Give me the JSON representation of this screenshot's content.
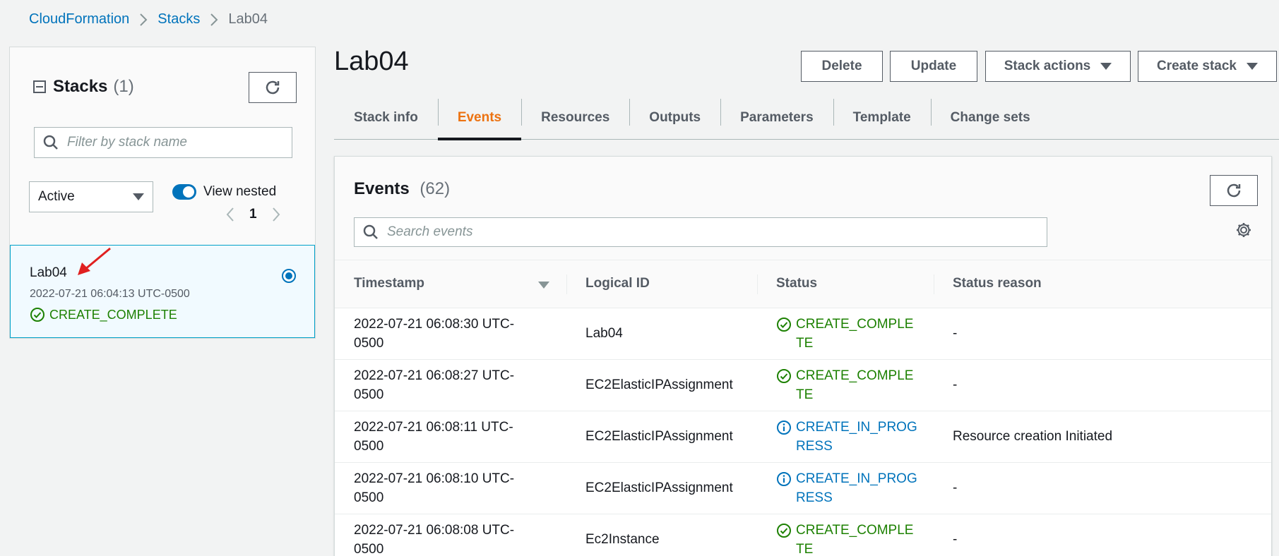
{
  "breadcrumb": {
    "items": [
      "CloudFormation",
      "Stacks"
    ],
    "current": "Lab04"
  },
  "sidebar": {
    "title": "Stacks",
    "count": "(1)",
    "filter_placeholder": "Filter by stack name",
    "status_filter": "Active",
    "view_nested_label": "View nested",
    "page": "1",
    "stack": {
      "name": "Lab04",
      "created": "2022-07-21 06:04:13 UTC-0500",
      "status": "CREATE_COMPLETE"
    }
  },
  "header": {
    "title": "Lab04",
    "buttons": {
      "delete": "Delete",
      "update": "Update",
      "stack_actions": "Stack actions",
      "create_stack": "Create stack"
    }
  },
  "tabs": [
    {
      "label": "Stack info"
    },
    {
      "label": "Events"
    },
    {
      "label": "Resources"
    },
    {
      "label": "Outputs"
    },
    {
      "label": "Parameters"
    },
    {
      "label": "Template"
    },
    {
      "label": "Change sets"
    }
  ],
  "events": {
    "title": "Events",
    "count": "(62)",
    "search_placeholder": "Search events",
    "columns": [
      "Timestamp",
      "Logical ID",
      "Status",
      "Status reason"
    ],
    "rows": [
      {
        "ts1": "2022-07-21 06:08:30 UTC-",
        "ts2": "0500",
        "logical_id": "Lab04",
        "status": "CREATE_COMPLETE",
        "reason": "-"
      },
      {
        "ts1": "2022-07-21 06:08:27 UTC-",
        "ts2": "0500",
        "logical_id": "EC2ElasticIPAssignment",
        "status": "CREATE_COMPLETE",
        "reason": "-"
      },
      {
        "ts1": "2022-07-21 06:08:11 UTC-",
        "ts2": "0500",
        "logical_id": "EC2ElasticIPAssignment",
        "status": "CREATE_IN_PROGRESS",
        "reason": "Resource creation Initiated"
      },
      {
        "ts1": "2022-07-21 06:08:10 UTC-",
        "ts2": "0500",
        "logical_id": "EC2ElasticIPAssignment",
        "status": "CREATE_IN_PROGRESS",
        "reason": "-"
      },
      {
        "ts1": "2022-07-21 06:08:08 UTC-",
        "ts2": "0500",
        "logical_id": "Ec2Instance",
        "status": "CREATE_COMPLETE",
        "reason": "-"
      }
    ]
  },
  "colors": {
    "link": "#0073bb",
    "active_tab": "#ec7211",
    "success": "#1d8102",
    "info": "#0073bb",
    "annotation_arrow": "#e02020"
  },
  "icons": {
    "refresh": "refresh-icon",
    "search": "search-icon",
    "gear": "gear-icon",
    "success": "check-circle-icon",
    "info": "info-circle-icon"
  }
}
